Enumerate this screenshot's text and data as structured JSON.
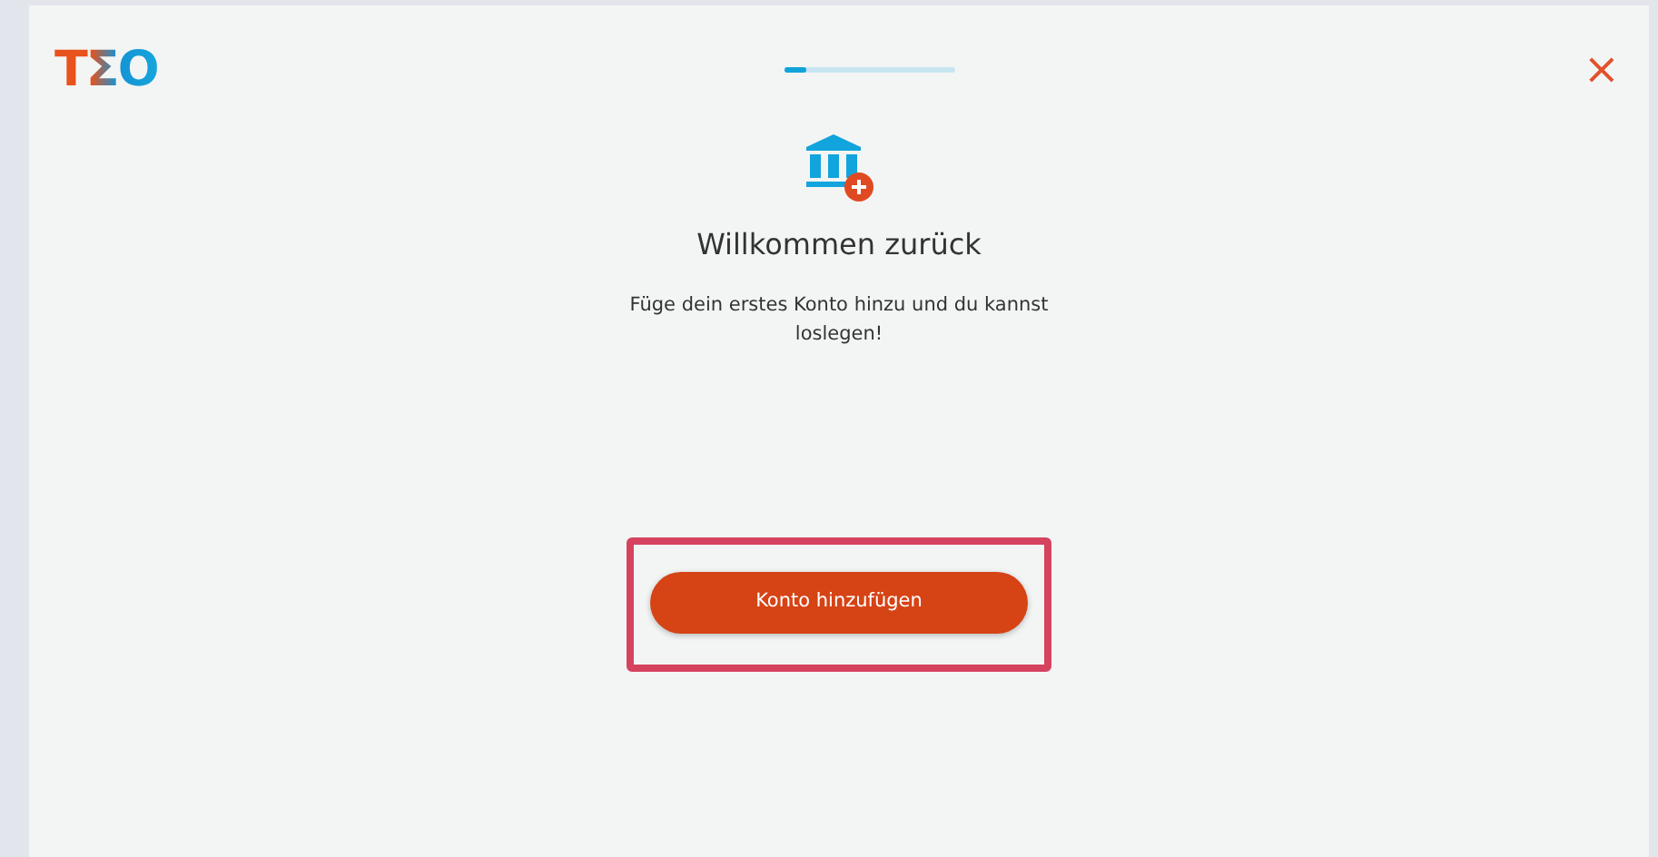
{
  "header": {
    "logo": "TΣO",
    "progress": {
      "level": 0.12
    },
    "close": "×"
  },
  "title": "Willkommen zurück",
  "message": "Füge dein erstes Konto hinzu und du kannst loslegen!",
  "button": {
    "label": "Konto hinzufügen",
    "highlighted": true
  }
}
